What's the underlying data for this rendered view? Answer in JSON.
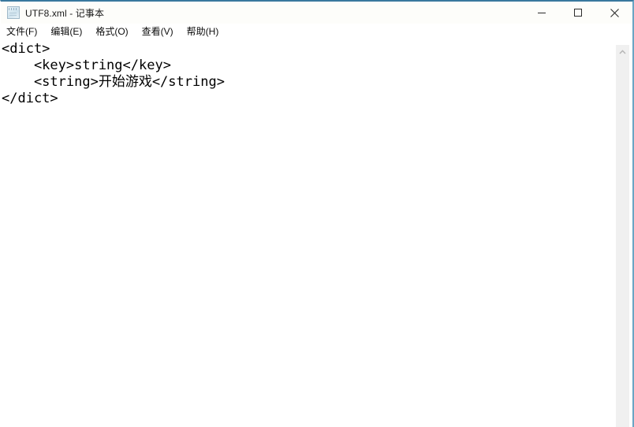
{
  "window": {
    "title": "UTF8.xml - 记事本",
    "icon": "notepad-icon",
    "accent_color": "#39789e",
    "titlebar_color": "#fdfdfa",
    "controls": {
      "minimize": "─",
      "maximize": "□",
      "close": "✕"
    }
  },
  "menubar": {
    "items": [
      {
        "label": "文件(F)"
      },
      {
        "label": "编辑(E)"
      },
      {
        "label": "格式(O)"
      },
      {
        "label": "查看(V)"
      },
      {
        "label": "帮助(H)"
      }
    ]
  },
  "editor": {
    "content": "<dict>\n    <key>string</key>\n    <string>开始游戏</string>\n</dict>",
    "lines": [
      "<dict>",
      "    <key>string</key>",
      "    <string>开始游戏</string>",
      "</dict>"
    ],
    "background": "#ffffff",
    "text_color": "#000000"
  },
  "scrollbar": {
    "up_arrow": "chevron-up-icon",
    "track_color": "#f0f0f0",
    "thumb_visible": false
  }
}
